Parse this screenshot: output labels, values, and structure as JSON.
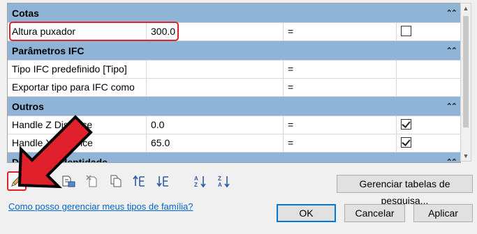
{
  "groups": [
    {
      "title": "Cotas",
      "rows": [
        {
          "name": "Altura puxador",
          "value": "300.0",
          "formula": "=",
          "checked": false
        }
      ]
    },
    {
      "title": "Parâmetros IFC",
      "rows": [
        {
          "name": "Tipo IFC predefinido [Tipo]",
          "value": "",
          "formula": "=",
          "checked": null
        },
        {
          "name": "Exportar tipo para IFC como",
          "value": "",
          "formula": "=",
          "checked": null
        }
      ]
    },
    {
      "title": "Outros",
      "rows": [
        {
          "name": "Handle Z Distance",
          "value": "0.0",
          "formula": "=",
          "checked": true
        },
        {
          "name": "Handle X Distance",
          "value": "65.0",
          "formula": "=",
          "checked": true
        }
      ]
    },
    {
      "title": "Dados de identidade",
      "rows": []
    }
  ],
  "toolbar": {
    "icons": [
      "edit-pencil-icon",
      "new-parameter-icon",
      "edit-parameter-icon",
      "delete-parameter-icon",
      "copy-parameter-icon",
      "move-up-icon",
      "move-down-icon",
      "sort-ascending-icon",
      "sort-descending-icon"
    ],
    "manage_lookup_label": "Gerenciar tabelas de pesquisa..."
  },
  "help_link": "Como posso gerenciar meus tipos de família?",
  "buttons": {
    "ok": "OK",
    "cancel": "Cancelar",
    "apply": "Aplicar"
  },
  "colors": {
    "group_header": "#8fb4d6",
    "highlight": "#e0202a",
    "link": "#0066cc"
  }
}
